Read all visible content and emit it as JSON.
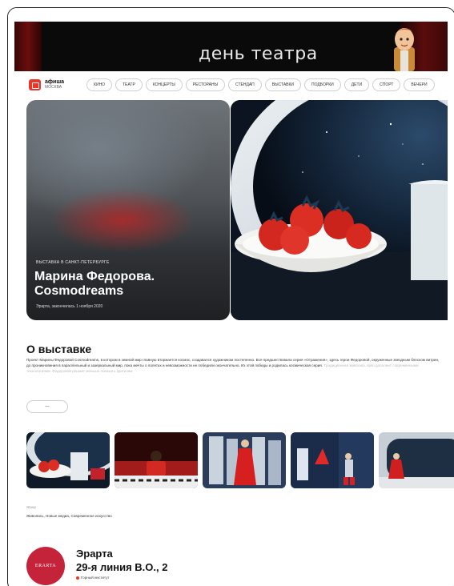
{
  "banner": {
    "title": "день театра"
  },
  "logo": {
    "name": "афиша",
    "city": "МОСКВА"
  },
  "nav": {
    "items": [
      "КИНО",
      "ТЕАТР",
      "КОНЦЕРТЫ",
      "РЕСТОРАНЫ",
      "СТЕНДАП",
      "ВЫСТАВКИ",
      "ПОДБОРКИ",
      "ДЕТИ",
      "СПОРТ",
      "ВЕЧЕРИ"
    ]
  },
  "hero": {
    "tag": "ВЫСТАВКА В САНКТ-ПЕТЕРБУРГЕ",
    "title_line1": "Марина Федорова.",
    "title_line2": "Cosmodreams",
    "subtitle": "Эрарта, закончилась 1 ноября 2020"
  },
  "about": {
    "title": "О выставке",
    "text": "Проект Марины Федоровой Cosmodreams, в котором в земной мир главную вторжается космос, создавался художником постепенно. Вся предшествовала серия «Отражения», здесь герои Федоровой, окруженные звездным блеском витрин, до проникновения в параллельный и зазеркальный мир, пока мечты о полетах и невозможности не победили окончательно. Из этой победы и родилась космическая серия.",
    "faded": "Традиционная живопись ярко дополнит современными технологиями. Федоровой решает меньше показать зрителям",
    "more_label": "..."
  },
  "genres": {
    "label": "Жанр",
    "value": "Живопись, Новые медиа, Современное искусство"
  },
  "venue": {
    "logo_text": "ERARTA",
    "name": "Эрарта",
    "address": "29-я линия В.О., 2",
    "metro": "Горный институт"
  },
  "colors": {
    "accent": "#e8362b",
    "venue": "#c5233a"
  }
}
